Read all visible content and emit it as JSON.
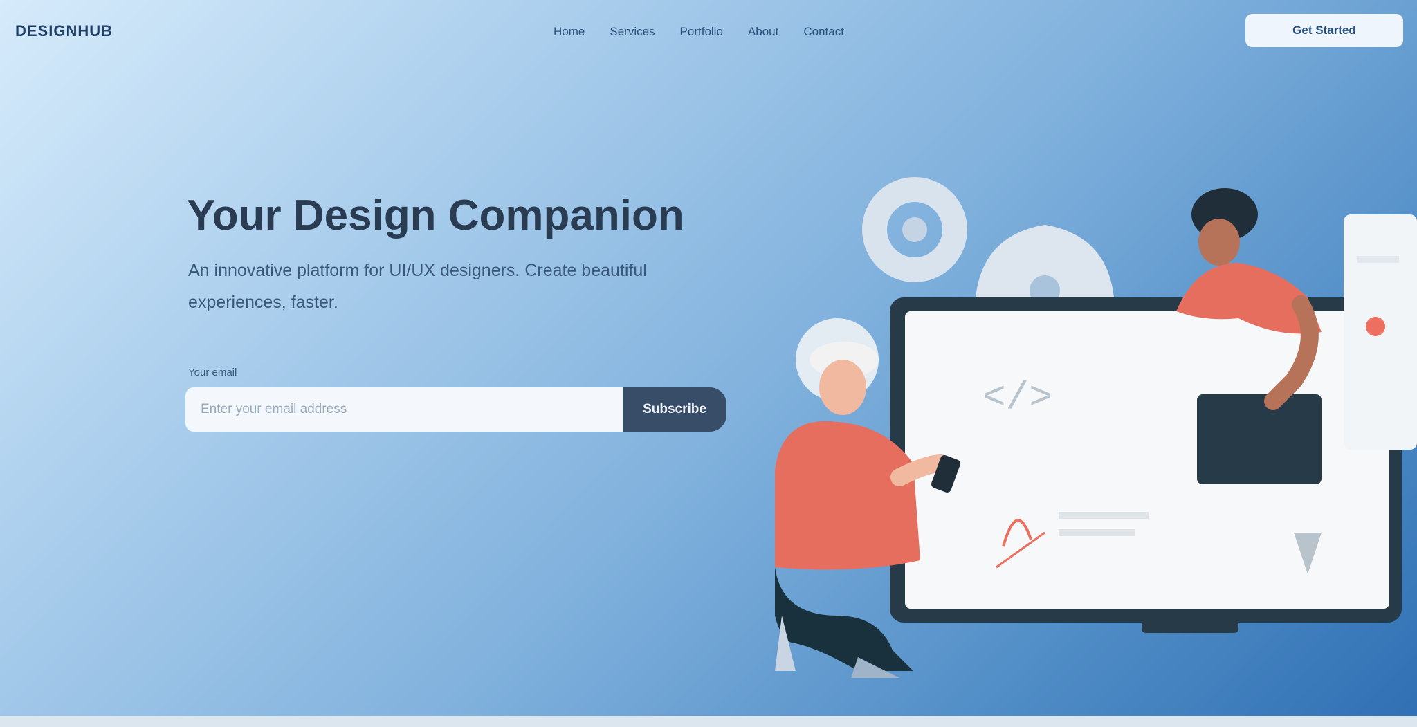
{
  "header": {
    "logo_text": "DESIGNHUB",
    "nav": [
      {
        "label": "Home"
      },
      {
        "label": "Services"
      },
      {
        "label": "Portfolio"
      },
      {
        "label": "About"
      },
      {
        "label": "Contact"
      }
    ],
    "cta_label": "Get Started"
  },
  "hero": {
    "title": "Your Design Companion",
    "subtitle": "An innovative platform for UI/UX designers. Create beautiful experiences, faster.",
    "field_label": "Your email",
    "input_placeholder": "Enter your email address",
    "submit_label": "Subscribe"
  },
  "colors": {
    "gradient_start": "#d6ebfb",
    "gradient_end": "#2f6fb3",
    "accent_coral": "#ec6f5f",
    "dark_navy": "#1f3a48",
    "button_dark": "#384d68"
  }
}
